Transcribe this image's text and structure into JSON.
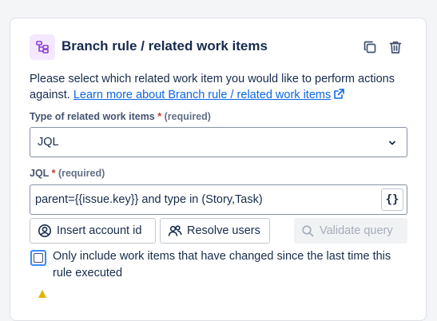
{
  "panel": {
    "title": "Branch rule / related work items",
    "icons": [
      "branch-rule-icon",
      "copy-icon",
      "trash-icon"
    ]
  },
  "description": {
    "text": "Please select which related work item you would like to perform actions against.",
    "link_text": "Learn more about Branch rule / related work items"
  },
  "type_field": {
    "label": "Type of related work items",
    "required_mark": "*",
    "required_text": "(required)",
    "value": "JQL"
  },
  "jql_field": {
    "label": "JQL",
    "required_mark": "*",
    "required_text": "(required)",
    "value": "parent={{issue.key}} and type in (Story,Task)",
    "smart_value_button": "{}"
  },
  "buttons": {
    "insert_account_id": "Insert account id",
    "resolve_users": "Resolve users",
    "validate_query": "Validate query"
  },
  "checkbox": {
    "label": "Only include work items that have changed since the last time this rule executed",
    "checked": false
  },
  "colors": {
    "accent": "#0c66e4",
    "required": "#c9372c",
    "icon_bg": "#f3e8fd",
    "icon_fg": "#8f3fd6",
    "focus": "#388bff"
  }
}
